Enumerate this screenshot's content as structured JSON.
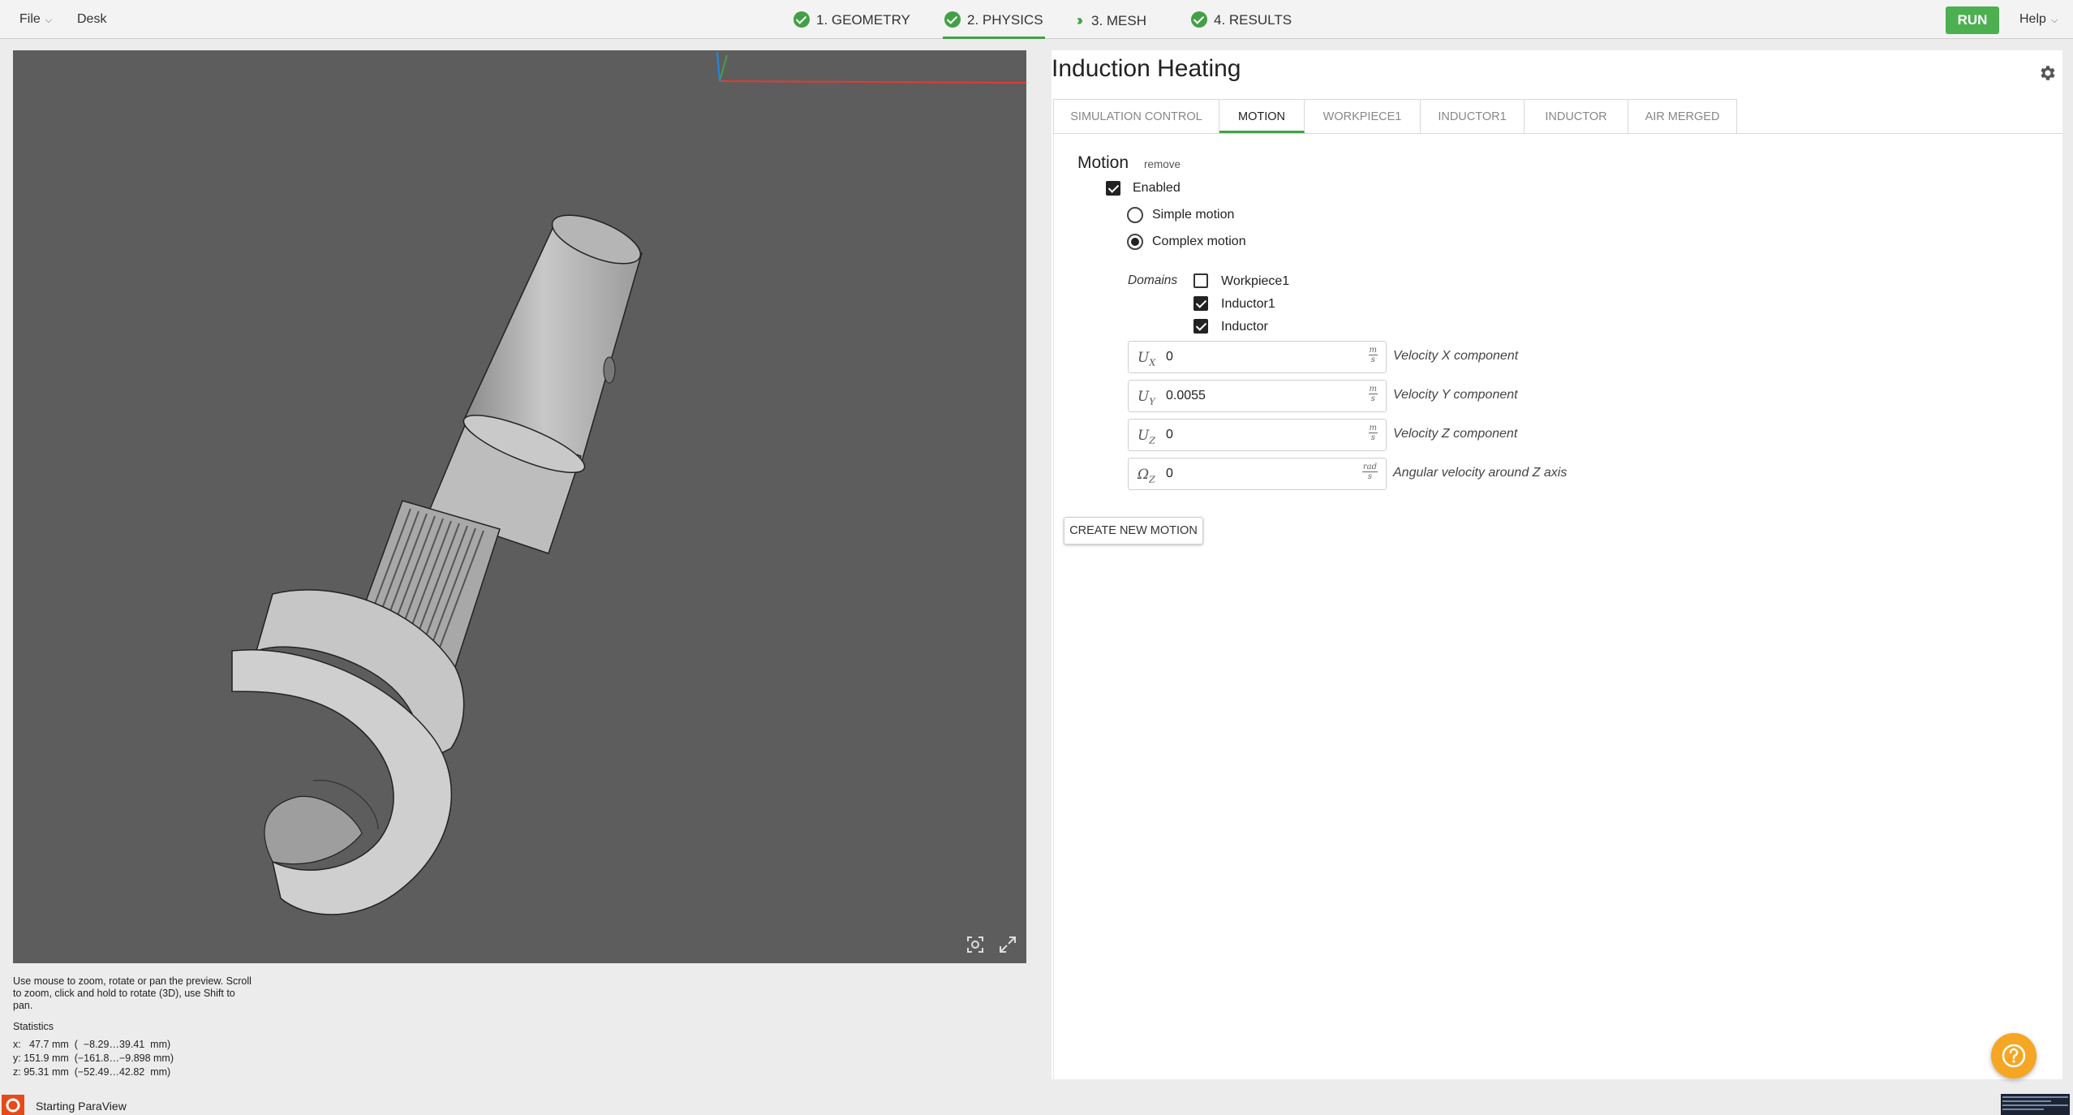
{
  "topbar": {
    "menus": [
      {
        "label": "File",
        "has_dropdown": true
      },
      {
        "label": "Desk",
        "has_dropdown": false
      }
    ],
    "steps": [
      {
        "label": "1. GEOMETRY",
        "state": "done"
      },
      {
        "label": "2. PHYSICS",
        "state": "done",
        "active": true
      },
      {
        "label": "3. MESH",
        "state": "next"
      },
      {
        "label": "4. RESULTS",
        "state": "done"
      }
    ],
    "run_label": "RUN",
    "help_label": "Help",
    "accent_color": "#4caf50"
  },
  "viewer": {
    "help_text": "Use mouse to zoom, rotate or pan the preview. Scroll to zoom, click and hold to rotate (3D), use Shift to pan.",
    "statistics_title": "Statistics",
    "stats": [
      "x:   47.7 mm  (  −8.29…39.41  mm)",
      "y: 151.9 mm  (−161.8…−9.898 mm)",
      "z: 95.31 mm  (−52.49…42.82  mm)"
    ],
    "icons": [
      "focus-icon",
      "expand-icon"
    ],
    "background_color": "#5d5d5d"
  },
  "panel": {
    "title": "Induction Heating",
    "tabs": [
      {
        "label": "SIMULATION CONTROL",
        "active": false
      },
      {
        "label": "MOTION",
        "active": true
      },
      {
        "label": "WORKPIECE1",
        "active": false
      },
      {
        "label": "INDUCTOR1",
        "active": false
      },
      {
        "label": "INDUCTOR",
        "active": false
      },
      {
        "label": "AIR MERGED",
        "active": false
      }
    ],
    "motion": {
      "section_title": "Motion",
      "remove_label": "remove",
      "enabled_label": "Enabled",
      "enabled": true,
      "motion_types": [
        {
          "label": "Simple motion",
          "selected": false
        },
        {
          "label": "Complex motion",
          "selected": true
        }
      ],
      "domains_label": "Domains",
      "domains": [
        {
          "label": "Workpiece1",
          "checked": false
        },
        {
          "label": "Inductor1",
          "checked": true
        },
        {
          "label": "Inductor",
          "checked": true
        }
      ],
      "fields": [
        {
          "symbol": "U",
          "sub": "X",
          "value": "0",
          "unit_num": "m",
          "unit_den": "s",
          "description": "Velocity X component"
        },
        {
          "symbol": "U",
          "sub": "Y",
          "value": "0.0055",
          "unit_num": "m",
          "unit_den": "s",
          "description": "Velocity Y component"
        },
        {
          "symbol": "U",
          "sub": "Z",
          "value": "0",
          "unit_num": "m",
          "unit_den": "s",
          "description": "Velocity Z component"
        },
        {
          "symbol": "Ω",
          "sub": "Z",
          "value": "0",
          "unit_num": "rad",
          "unit_den": "s",
          "description": "Angular velocity around Z axis"
        }
      ],
      "create_button_label": "CREATE NEW MOTION"
    }
  },
  "statusbar": {
    "text": "Starting ParaView"
  }
}
